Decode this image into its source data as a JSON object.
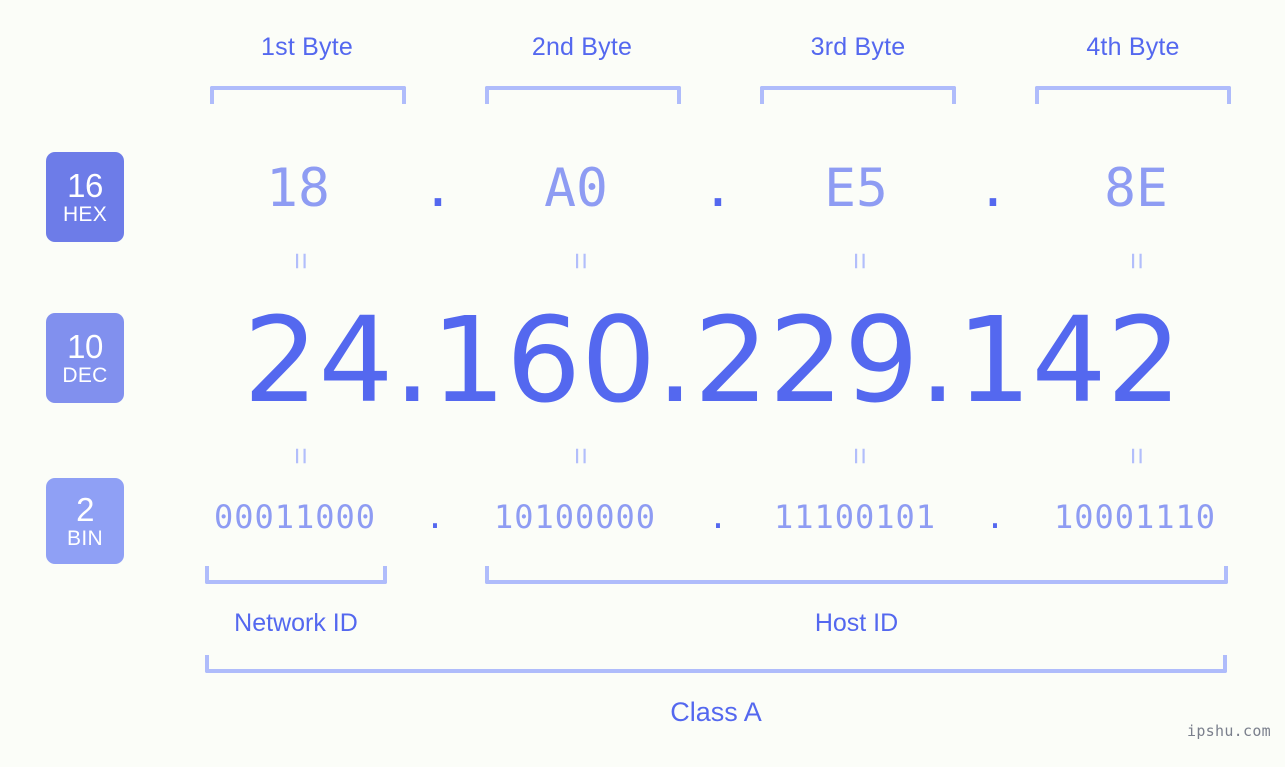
{
  "watermark": "ipshu.com",
  "class_label": "Class A",
  "byte_headers": [
    {
      "label": "1st Byte"
    },
    {
      "label": "2nd Byte"
    },
    {
      "label": "3rd Byte"
    },
    {
      "label": "4th Byte"
    }
  ],
  "bases": [
    {
      "number": "16",
      "name": "HEX",
      "color": "#6d7ce8"
    },
    {
      "number": "10",
      "name": "DEC",
      "color": "#8190ee"
    },
    {
      "number": "2",
      "name": "BIN",
      "color": "#8fa0f5"
    }
  ],
  "separators": {
    "dot": ".",
    "equals": "="
  },
  "rows": {
    "hex": {
      "values": [
        "18",
        "A0",
        "E5",
        "8E"
      ]
    },
    "dec": {
      "values": [
        "24",
        "160",
        "229",
        "142"
      ]
    },
    "bin": {
      "values": [
        "00011000",
        "10100000",
        "11100101",
        "10001110"
      ]
    }
  },
  "id_sections": [
    {
      "label": "Network ID"
    },
    {
      "label": "Host ID"
    }
  ],
  "colors": {
    "background": "#fbfdf8",
    "accent_strong": "#5468ef",
    "accent_mid": "#8e9cf3",
    "accent_light": "#afbcfb"
  }
}
